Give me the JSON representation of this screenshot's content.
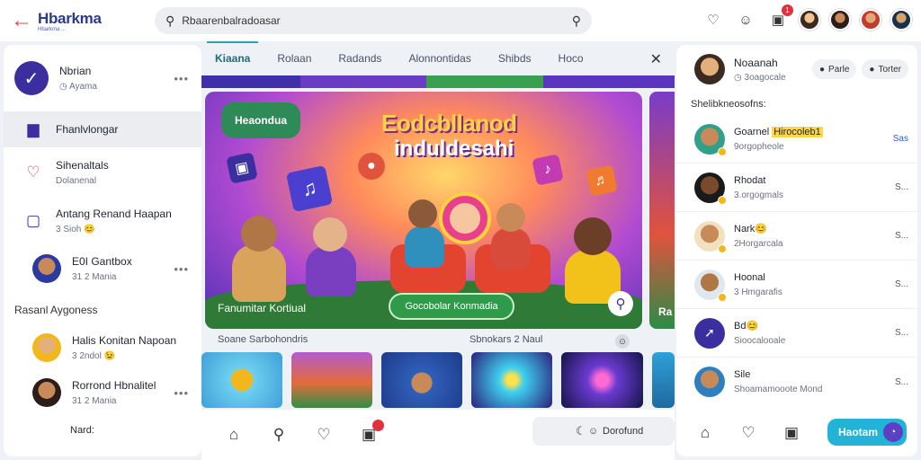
{
  "header": {
    "brand": "Hbarkma",
    "brand_sub": "Hbarkma ...",
    "search_value": "Rbaarenbalradoasar",
    "notification_count": "1",
    "colors": {
      "accent": "#2d3a8c",
      "back": "#e2473c"
    }
  },
  "left": {
    "profile": {
      "name": "Nbrian",
      "sub": "Ayama"
    },
    "items": [
      {
        "title": "Fhanlvlongar",
        "icon": "bus-icon"
      },
      {
        "title": "Sihenaltals",
        "sub": "Dolanenal",
        "icon": "heart-check-icon"
      },
      {
        "title": "Antang Renand Haapan",
        "sub": "3 Sioh 😊",
        "icon": "square-icon"
      },
      {
        "title": "E0I Gantbox",
        "sub": "31  2 Mania"
      }
    ],
    "section": "Rasanl Aygoness",
    "people": [
      {
        "title": "Halis Konitan Napoan",
        "sub": "3  2ndol 😉"
      },
      {
        "title": "Rorrond Hbnalitel",
        "sub": "31  2 Mania"
      }
    ],
    "footer": "Nard:"
  },
  "center": {
    "tabs": [
      "Kiaana",
      "Rolaan",
      "Radands",
      "Alonnontidas",
      "Shibds",
      "Hoco"
    ],
    "hero": {
      "bubble": "Heaondua",
      "title1": "Eodcbllanod",
      "title2": "induldesahi",
      "label": "Fanumitar Kortiual",
      "button": "Gocobolar Konmadia",
      "side_label": "Ra"
    },
    "row_labels": [
      "Soane Sarbohondris",
      "Sbnokars 2 Naul"
    ],
    "thumbs": [
      "",
      "",
      "",
      "",
      ""
    ],
    "toggle": "Dorofund"
  },
  "right": {
    "profile": {
      "name": "Noaanah",
      "sub": "3oagocale"
    },
    "pills": [
      "Parle",
      "Torter"
    ],
    "section": "Shelibkneosofns:",
    "people": [
      {
        "title": "Goarnel",
        "highlight": "Hirocoleb1",
        "sub": "9orgopheole",
        "action": "Sas"
      },
      {
        "title": "Rhodat",
        "sub": "3.orgogmals",
        "action": "S..."
      },
      {
        "title": "Nark😊",
        "sub": "2Horgarcala",
        "action": "S..."
      },
      {
        "title": "Hoonal",
        "sub": "3 Hmgarafis",
        "action": "S..."
      },
      {
        "title": "Bd😊",
        "sub": "Sioocalooale",
        "action": "S..."
      },
      {
        "title": "Sile",
        "sub": "Shoamamooote Mond",
        "action": "S..."
      }
    ],
    "cta": "Haotam"
  }
}
